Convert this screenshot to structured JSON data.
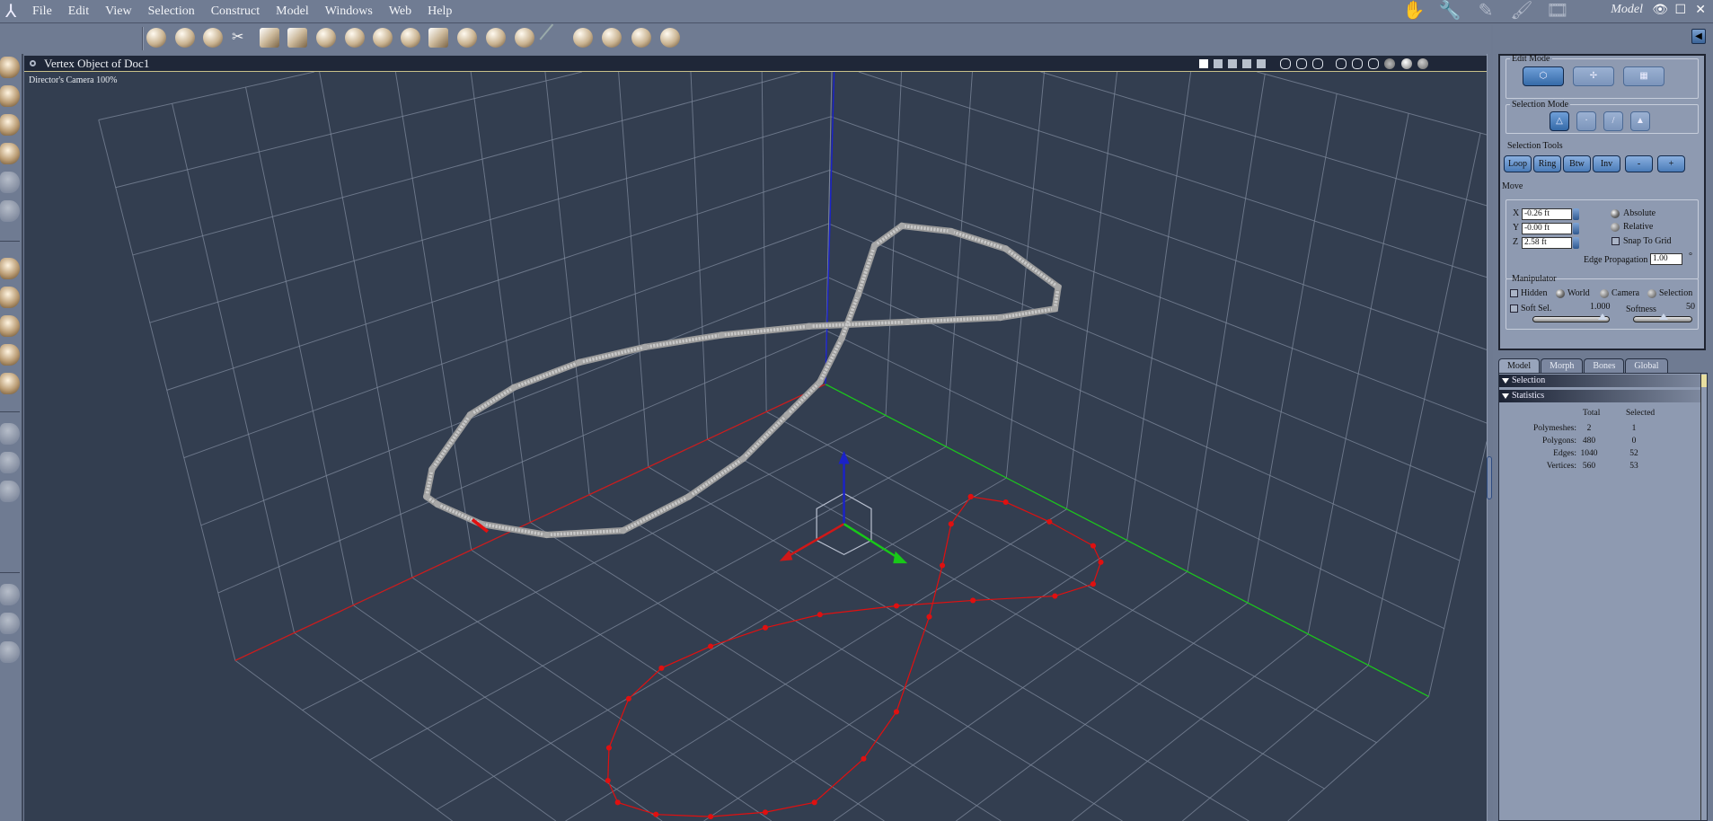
{
  "menubar": {
    "items": [
      "File",
      "Edit",
      "View",
      "Selection",
      "Construct",
      "Model",
      "Windows",
      "Web",
      "Help"
    ],
    "room_label": "Model",
    "rooms": [
      "hand-room-icon",
      "wrench-room-icon",
      "pencil-room-icon",
      "brush-room-icon",
      "film-room-icon"
    ]
  },
  "viewport": {
    "title": "Vertex Object of Doc1",
    "camera_label": "Director's Camera 100%"
  },
  "panel": {
    "edit_mode": {
      "label": "Edit Mode"
    },
    "selection_mode": {
      "label": "Selection Mode"
    },
    "selection_tools": {
      "label": "Selection Tools",
      "buttons": [
        "Loop",
        "Ring",
        "Btw",
        "Inv",
        "-",
        "+"
      ]
    },
    "move": {
      "label": "Move",
      "x_label": "X",
      "y_label": "Y",
      "z_label": "Z",
      "x": "-0.26 ft",
      "y": "-0.00 ft",
      "z": "2.58 ft",
      "absolute": "Absolute",
      "relative": "Relative",
      "snap": "Snap To Grid",
      "edge_prop_label": "Edge Propagation",
      "edge_prop": "1.00",
      "degree": "°"
    },
    "manipulator": {
      "label": "Manipulator",
      "hidden": "Hidden",
      "world": "World",
      "camera": "Camera",
      "selection": "Selection",
      "soft_sel": "Soft Sel.",
      "soft_val": "1.000",
      "softness": "Softness",
      "softness_val": "50",
      "soft_fraction": 0.9,
      "softness_fraction": 0.5
    }
  },
  "tabs": [
    "Model",
    "Morph",
    "Bones",
    "Global"
  ],
  "sections": {
    "selection": "Selection",
    "statistics": "Statistics"
  },
  "stats": {
    "headers": [
      "Total",
      "Selected"
    ],
    "rows": [
      {
        "label": "Polymeshes:",
        "total": "2",
        "selected": "1"
      },
      {
        "label": "Polygons:",
        "total": "480",
        "selected": "0"
      },
      {
        "label": "Edges:",
        "total": "1040",
        "selected": "52"
      },
      {
        "label": "Vertices:",
        "total": "560",
        "selected": "53"
      }
    ]
  },
  "colors": {
    "x_axis": "#d01818",
    "y_axis": "#1a22c8",
    "z_axis": "#18c818",
    "selected": "#e01010",
    "mesh": "#c8c8c8"
  }
}
